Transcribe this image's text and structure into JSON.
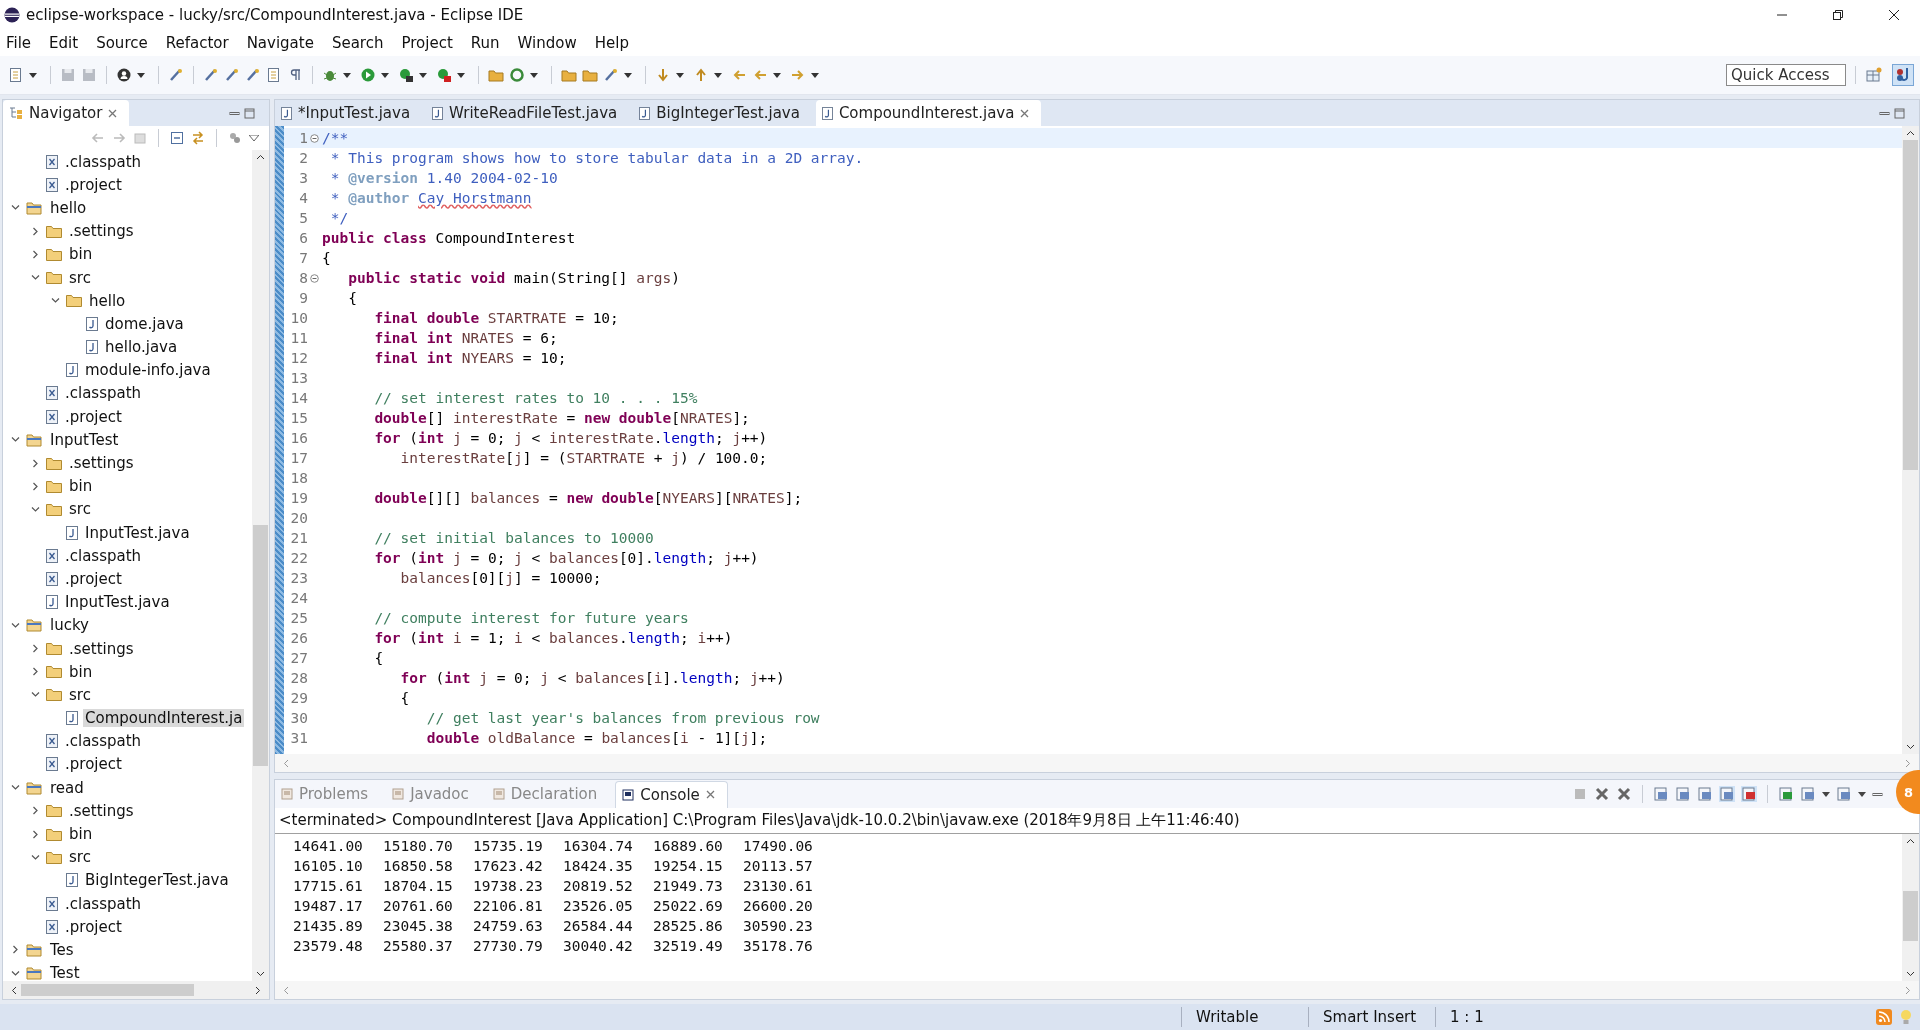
{
  "window": {
    "title": "eclipse-workspace - lucky/src/CompoundInterest.java - Eclipse IDE"
  },
  "menu": [
    "File",
    "Edit",
    "Source",
    "Refactor",
    "Navigate",
    "Search",
    "Project",
    "Run",
    "Window",
    "Help"
  ],
  "quick_access": {
    "placeholder": "Quick Access"
  },
  "navigator": {
    "title": "Navigator",
    "items": [
      {
        "children": [
          {
            "label": ".classpath",
            "kind": "xfile"
          },
          {
            "label": ".project",
            "kind": "xfile"
          }
        ]
      },
      {
        "label": "hello",
        "kind": "project",
        "expanded": true,
        "selected": false,
        "children": [
          {
            "label": ".settings",
            "kind": "folder",
            "expanded": false,
            "selected": false
          },
          {
            "label": "bin",
            "kind": "folder",
            "expanded": false,
            "selected": false
          },
          {
            "label": "src",
            "kind": "folder",
            "expanded": true,
            "selected": false,
            "children": [
              {
                "label": "hello",
                "kind": "folder",
                "expanded": true,
                "selected": false,
                "children": [
                  {
                    "label": "dome.java",
                    "kind": "jfile",
                    "selected": false
                  },
                  {
                    "label": "hello.java",
                    "kind": "jfile",
                    "selected": false
                  }
                ]
              },
              {
                "label": "module-info.java",
                "kind": "jfile",
                "selected": false
              }
            ]
          },
          {
            "label": ".classpath",
            "kind": "xfile",
            "selected": false
          },
          {
            "label": ".project",
            "kind": "xfile",
            "selected": false
          }
        ]
      },
      {
        "label": "InputTest",
        "kind": "project",
        "expanded": true,
        "selected": false,
        "children": [
          {
            "label": ".settings",
            "kind": "folder",
            "expanded": false,
            "selected": false
          },
          {
            "label": "bin",
            "kind": "folder",
            "expanded": false,
            "selected": false
          },
          {
            "label": "src",
            "kind": "folder",
            "expanded": true,
            "selected": false,
            "children": [
              {
                "label": "InputTest.java",
                "kind": "jfile",
                "selected": false
              }
            ]
          },
          {
            "label": ".classpath",
            "kind": "xfile",
            "selected": false
          },
          {
            "label": ".project",
            "kind": "xfile",
            "selected": false
          },
          {
            "label": "InputTest.java",
            "kind": "jfile",
            "selected": false
          }
        ]
      },
      {
        "label": "lucky",
        "kind": "project",
        "expanded": true,
        "selected": false,
        "children": [
          {
            "label": ".settings",
            "kind": "folder",
            "expanded": false,
            "selected": false
          },
          {
            "label": "bin",
            "kind": "folder",
            "expanded": false,
            "selected": false
          },
          {
            "label": "src",
            "kind": "folder",
            "expanded": true,
            "selected": false,
            "children": [
              {
                "label": "CompoundInterest.ja",
                "kind": "jfile",
                "selected": true
              }
            ]
          },
          {
            "label": ".classpath",
            "kind": "xfile",
            "selected": false
          },
          {
            "label": ".project",
            "kind": "xfile",
            "selected": false
          }
        ]
      },
      {
        "label": "read",
        "kind": "project",
        "expanded": true,
        "selected": false,
        "children": [
          {
            "label": ".settings",
            "kind": "folder",
            "expanded": false,
            "selected": false
          },
          {
            "label": "bin",
            "kind": "folder",
            "expanded": false,
            "selected": false
          },
          {
            "label": "src",
            "kind": "folder",
            "expanded": true,
            "selected": false,
            "children": [
              {
                "label": "BigIntegerTest.java",
                "kind": "jfile",
                "selected": false
              }
            ]
          },
          {
            "label": ".classpath",
            "kind": "xfile",
            "selected": false
          },
          {
            "label": ".project",
            "kind": "xfile",
            "selected": false
          }
        ]
      },
      {
        "label": "Tes",
        "kind": "project",
        "expanded": false,
        "selected": false
      },
      {
        "label": "Test",
        "kind": "project",
        "expanded": true,
        "selected": false
      }
    ]
  },
  "editor": {
    "tabs": [
      {
        "label": "*InputTest.java",
        "selected": false
      },
      {
        "label": "WriteReadFileTest.java",
        "selected": false
      },
      {
        "label": "BigIntegerTest.java",
        "selected": false
      },
      {
        "label": "CompoundInterest.java",
        "selected": true
      }
    ],
    "lines": [
      {
        "number": "1",
        "foldable": true,
        "segments": [
          {
            "kind": "doc",
            "text": "/**"
          }
        ]
      },
      {
        "number": "2",
        "foldable": false,
        "segments": [
          {
            "kind": "doc",
            "text": " * This program shows how to store tabular data in a 2D array."
          }
        ]
      },
      {
        "number": "3",
        "foldable": false,
        "segments": [
          {
            "kind": "doc",
            "text": " * "
          },
          {
            "kind": "doctag",
            "text": "@version"
          },
          {
            "kind": "doc",
            "text": " 1.40 2004-02-10"
          }
        ]
      },
      {
        "number": "4",
        "foldable": false,
        "segments": [
          {
            "kind": "doc",
            "text": " * "
          },
          {
            "kind": "doctag",
            "text": "@author "
          },
          {
            "kind": "spell",
            "text": "Cay Horstmann"
          }
        ]
      },
      {
        "number": "5",
        "foldable": false,
        "segments": [
          {
            "kind": "doc",
            "text": " */"
          }
        ]
      },
      {
        "number": "6",
        "foldable": false,
        "segments": [
          {
            "kind": "kw",
            "text": "public class"
          },
          {
            "kind": "plain",
            "text": " CompoundInterest"
          }
        ]
      },
      {
        "number": "7",
        "foldable": false,
        "segments": [
          {
            "kind": "plain",
            "text": "{"
          }
        ]
      },
      {
        "number": "8",
        "foldable": true,
        "segments": [
          {
            "kind": "kw",
            "text": "   public static void"
          },
          {
            "kind": "plain",
            "text": " main(String[] "
          },
          {
            "kind": "var",
            "text": "args"
          },
          {
            "kind": "plain",
            "text": ")"
          }
        ]
      },
      {
        "number": "9",
        "foldable": false,
        "segments": [
          {
            "kind": "plain",
            "text": "   {"
          }
        ]
      },
      {
        "number": "10",
        "foldable": false,
        "segments": [
          {
            "kind": "kw",
            "text": "      final double"
          },
          {
            "kind": "var",
            "text": " STARTRATE"
          },
          {
            "kind": "plain",
            "text": " = 10;"
          }
        ]
      },
      {
        "number": "11",
        "foldable": false,
        "segments": [
          {
            "kind": "kw",
            "text": "      final int"
          },
          {
            "kind": "var",
            "text": " NRATES"
          },
          {
            "kind": "plain",
            "text": " = 6;"
          }
        ]
      },
      {
        "number": "12",
        "foldable": false,
        "segments": [
          {
            "kind": "kw",
            "text": "      final int"
          },
          {
            "kind": "var",
            "text": " NYEARS"
          },
          {
            "kind": "plain",
            "text": " = 10;"
          }
        ]
      },
      {
        "number": "13",
        "foldable": false
      },
      {
        "number": "14",
        "foldable": false,
        "segments": [
          {
            "kind": "comment",
            "text": "      // set interest rates to 10 . . . 15%"
          }
        ]
      },
      {
        "number": "15",
        "foldable": false,
        "segments": [
          {
            "kind": "kw",
            "text": "      double"
          },
          {
            "kind": "plain",
            "text": "[] "
          },
          {
            "kind": "var",
            "text": "interestRate"
          },
          {
            "kind": "plain",
            "text": " = "
          },
          {
            "kind": "kw",
            "text": "new double"
          },
          {
            "kind": "plain",
            "text": "["
          },
          {
            "kind": "var",
            "text": "NRATES"
          },
          {
            "kind": "plain",
            "text": "];"
          }
        ]
      },
      {
        "number": "16",
        "foldable": false,
        "segments": [
          {
            "kind": "kw",
            "text": "      for"
          },
          {
            "kind": "plain",
            "text": " ("
          },
          {
            "kind": "kw",
            "text": "int"
          },
          {
            "kind": "var",
            "text": " j"
          },
          {
            "kind": "plain",
            "text": " = 0; "
          },
          {
            "kind": "var",
            "text": "j"
          },
          {
            "kind": "plain",
            "text": " < "
          },
          {
            "kind": "var",
            "text": "interestRate"
          },
          {
            "kind": "plain",
            "text": "."
          },
          {
            "kind": "field",
            "text": "length"
          },
          {
            "kind": "plain",
            "text": "; "
          },
          {
            "kind": "var",
            "text": "j"
          },
          {
            "kind": "plain",
            "text": "++)"
          }
        ]
      },
      {
        "number": "17",
        "foldable": false,
        "segments": [
          {
            "kind": "var",
            "text": "         interestRate"
          },
          {
            "kind": "plain",
            "text": "["
          },
          {
            "kind": "var",
            "text": "j"
          },
          {
            "kind": "plain",
            "text": "] = ("
          },
          {
            "kind": "var",
            "text": "STARTRATE"
          },
          {
            "kind": "plain",
            "text": " + "
          },
          {
            "kind": "var",
            "text": "j"
          },
          {
            "kind": "plain",
            "text": ") / 100.0;"
          }
        ]
      },
      {
        "number": "18",
        "foldable": false
      },
      {
        "number": "19",
        "foldable": false,
        "segments": [
          {
            "kind": "kw",
            "text": "      double"
          },
          {
            "kind": "plain",
            "text": "[][] "
          },
          {
            "kind": "var",
            "text": "balances"
          },
          {
            "kind": "plain",
            "text": " = "
          },
          {
            "kind": "kw",
            "text": "new double"
          },
          {
            "kind": "plain",
            "text": "["
          },
          {
            "kind": "var",
            "text": "NYEARS"
          },
          {
            "kind": "plain",
            "text": "]["
          },
          {
            "kind": "var",
            "text": "NRATES"
          },
          {
            "kind": "plain",
            "text": "];"
          }
        ]
      },
      {
        "number": "20",
        "foldable": false
      },
      {
        "number": "21",
        "foldable": false,
        "segments": [
          {
            "kind": "comment",
            "text": "      // set initial balances to 10000"
          }
        ]
      },
      {
        "number": "22",
        "foldable": false,
        "segments": [
          {
            "kind": "kw",
            "text": "      for"
          },
          {
            "kind": "plain",
            "text": " ("
          },
          {
            "kind": "kw",
            "text": "int"
          },
          {
            "kind": "var",
            "text": " j"
          },
          {
            "kind": "plain",
            "text": " = 0; "
          },
          {
            "kind": "var",
            "text": "j"
          },
          {
            "kind": "plain",
            "text": " < "
          },
          {
            "kind": "var",
            "text": "balances"
          },
          {
            "kind": "plain",
            "text": "[0]."
          },
          {
            "kind": "field",
            "text": "length"
          },
          {
            "kind": "plain",
            "text": "; "
          },
          {
            "kind": "var",
            "text": "j"
          },
          {
            "kind": "plain",
            "text": "++)"
          }
        ]
      },
      {
        "number": "23",
        "foldable": false,
        "segments": [
          {
            "kind": "var",
            "text": "         balances"
          },
          {
            "kind": "plain",
            "text": "[0]["
          },
          {
            "kind": "var",
            "text": "j"
          },
          {
            "kind": "plain",
            "text": "] = 10000;"
          }
        ]
      },
      {
        "number": "24",
        "foldable": false
      },
      {
        "number": "25",
        "foldable": false,
        "segments": [
          {
            "kind": "comment",
            "text": "      // compute interest for future years"
          }
        ]
      },
      {
        "number": "26",
        "foldable": false,
        "segments": [
          {
            "kind": "kw",
            "text": "      for"
          },
          {
            "kind": "plain",
            "text": " ("
          },
          {
            "kind": "kw",
            "text": "int"
          },
          {
            "kind": "var",
            "text": " i"
          },
          {
            "kind": "plain",
            "text": " = 1; "
          },
          {
            "kind": "var",
            "text": "i"
          },
          {
            "kind": "plain",
            "text": " < "
          },
          {
            "kind": "var",
            "text": "balances"
          },
          {
            "kind": "plain",
            "text": "."
          },
          {
            "kind": "field",
            "text": "length"
          },
          {
            "kind": "plain",
            "text": "; "
          },
          {
            "kind": "var",
            "text": "i"
          },
          {
            "kind": "plain",
            "text": "++)"
          }
        ]
      },
      {
        "number": "27",
        "foldable": false,
        "segments": [
          {
            "kind": "plain",
            "text": "      {"
          }
        ]
      },
      {
        "number": "28",
        "foldable": false,
        "segments": [
          {
            "kind": "kw",
            "text": "         for"
          },
          {
            "kind": "plain",
            "text": " ("
          },
          {
            "kind": "kw",
            "text": "int"
          },
          {
            "kind": "var",
            "text": " j"
          },
          {
            "kind": "plain",
            "text": " = 0; "
          },
          {
            "kind": "var",
            "text": "j"
          },
          {
            "kind": "plain",
            "text": " < "
          },
          {
            "kind": "var",
            "text": "balances"
          },
          {
            "kind": "plain",
            "text": "["
          },
          {
            "kind": "var",
            "text": "i"
          },
          {
            "kind": "plain",
            "text": "]."
          },
          {
            "kind": "field",
            "text": "length"
          },
          {
            "kind": "plain",
            "text": "; "
          },
          {
            "kind": "var",
            "text": "j"
          },
          {
            "kind": "plain",
            "text": "++)"
          }
        ]
      },
      {
        "number": "29",
        "foldable": false,
        "segments": [
          {
            "kind": "plain",
            "text": "         {"
          }
        ]
      },
      {
        "number": "30",
        "foldable": false,
        "segments": [
          {
            "kind": "comment",
            "text": "            // get last year's balances from previous row"
          }
        ]
      },
      {
        "number": "31",
        "foldable": false,
        "segments": [
          {
            "kind": "kw",
            "text": "            double"
          },
          {
            "kind": "var",
            "text": " oldBalance"
          },
          {
            "kind": "plain",
            "text": " = "
          },
          {
            "kind": "var",
            "text": "balances"
          },
          {
            "kind": "plain",
            "text": "["
          },
          {
            "kind": "var",
            "text": "i"
          },
          {
            "kind": "plain",
            "text": " - 1]["
          },
          {
            "kind": "var",
            "text": "j"
          },
          {
            "kind": "plain",
            "text": "];"
          }
        ]
      }
    ]
  },
  "console": {
    "tabs": [
      {
        "label": "Problems",
        "selected": false
      },
      {
        "label": "Javadoc",
        "selected": false
      },
      {
        "label": "Declaration",
        "selected": false
      },
      {
        "label": "Console",
        "selected": true
      }
    ],
    "header": "<terminated> CompoundInterest [Java Application] C:\\Program Files\\Java\\jdk-10.0.2\\bin\\javaw.exe (2018年9月8日 上午11:46:40)",
    "rows": [
      [
        "14641.00",
        "15180.70",
        "15735.19",
        "16304.74",
        "16889.60",
        "17490.06"
      ],
      [
        "16105.10",
        "16850.58",
        "17623.42",
        "18424.35",
        "19254.15",
        "20113.57"
      ],
      [
        "17715.61",
        "18704.15",
        "19738.23",
        "20819.52",
        "21949.73",
        "23130.61"
      ],
      [
        "19487.17",
        "20761.60",
        "22106.81",
        "23526.05",
        "25022.69",
        "26600.20"
      ],
      [
        "21435.89",
        "23045.38",
        "24759.63",
        "26584.44",
        "28525.86",
        "30590.23"
      ],
      [
        "23579.48",
        "25580.37",
        "27730.79",
        "30040.42",
        "32519.49",
        "35178.76"
      ]
    ]
  },
  "badge": {
    "text": "8"
  },
  "status_bar": [
    "Writable",
    "Smart Insert",
    "1 : 1"
  ]
}
